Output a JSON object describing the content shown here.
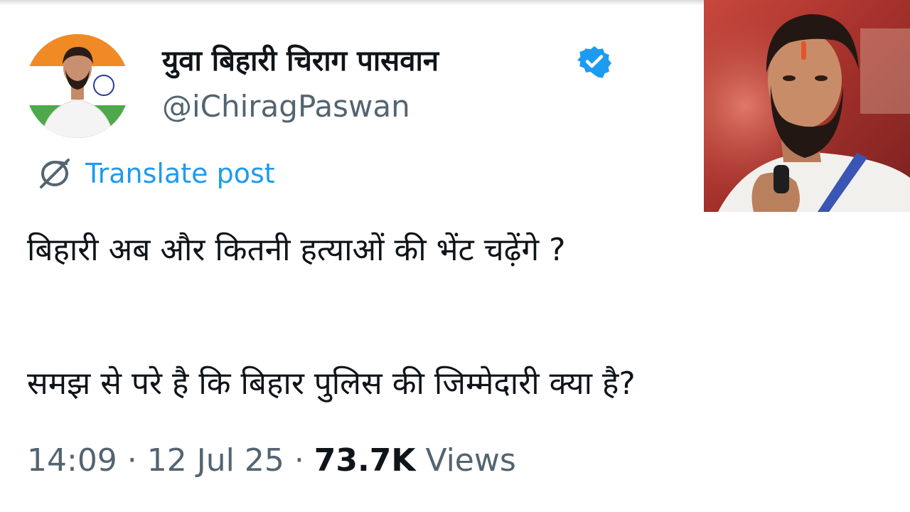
{
  "profile": {
    "display_name": "युवा बिहारी चिराग पासवान",
    "handle": "@iChiragPaswan",
    "avatar_icon": "profile-photo",
    "verified_icon": "verified-badge-icon",
    "verified_color": "#1d9bf0"
  },
  "translate": {
    "icon": "globe-icon",
    "label": "Translate post",
    "color": "#1d9bf0"
  },
  "tweet": {
    "line1": "बिहारी अब और कितनी हत्याओं की भेंट चढ़ेंगे ?",
    "line2": "समझ से परे है कि बिहार पुलिस की जिम्मेदारी क्या है?"
  },
  "meta": {
    "time": "14:09",
    "separator": " · ",
    "date": "12 Jul 25",
    "views_count": "73.7K",
    "views_label": " Views"
  },
  "inset_photo": {
    "description_icon": "person-photo"
  }
}
